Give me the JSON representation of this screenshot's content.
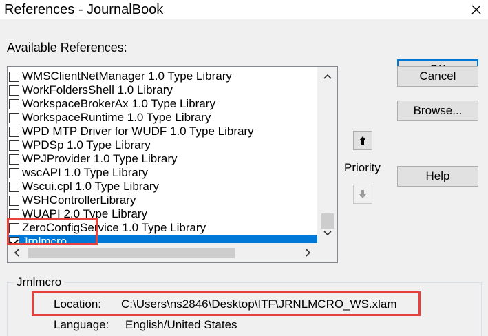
{
  "window": {
    "title": "References - JournalBook",
    "close_icon": "close-icon"
  },
  "available_references_label": "Available References:",
  "references": [
    {
      "label": "WMSClientNetManager 1.0 Type Library",
      "checked": false,
      "selected": false
    },
    {
      "label": "WorkFoldersShell 1.0 Library",
      "checked": false,
      "selected": false
    },
    {
      "label": "WorkspaceBrokerAx 1.0 Type Library",
      "checked": false,
      "selected": false
    },
    {
      "label": "WorkspaceRuntime 1.0 Type Library",
      "checked": false,
      "selected": false
    },
    {
      "label": "WPD MTP Driver for WUDF 1.0 Type Library",
      "checked": false,
      "selected": false
    },
    {
      "label": "WPDSp 1.0 Type Library",
      "checked": false,
      "selected": false
    },
    {
      "label": "WPJProvider 1.0 Type Library",
      "checked": false,
      "selected": false
    },
    {
      "label": "wscAPI 1.0 Type Library",
      "checked": false,
      "selected": false
    },
    {
      "label": "Wscui.cpl 1.0 Type Library",
      "checked": false,
      "selected": false
    },
    {
      "label": "WSHControllerLibrary",
      "checked": false,
      "selected": false
    },
    {
      "label": "WUAPI 2.0 Type Library",
      "checked": false,
      "selected": false
    },
    {
      "label": "ZeroConfigService 1.0 Type Library",
      "checked": false,
      "selected": false
    },
    {
      "label": "Jrnlmcro",
      "checked": true,
      "selected": true
    }
  ],
  "buttons": {
    "ok": "OK",
    "cancel": "Cancel",
    "browse": "Browse...",
    "help": "Help"
  },
  "priority": {
    "label": "Priority",
    "up_icon": "arrow-up-icon",
    "down_icon": "arrow-down-icon"
  },
  "details": {
    "group_title": "Jrnlmcro",
    "location_label": "Location:",
    "location_value": "C:\\Users\\ns2846\\Desktop\\ITF\\JRNLMCRO_WS.xlam",
    "language_label": "Language:",
    "language_value": "English/United States"
  },
  "colors": {
    "selection": "#0078d7",
    "annotation": "#e8403c",
    "dialog_bg": "#f0f0f0"
  }
}
